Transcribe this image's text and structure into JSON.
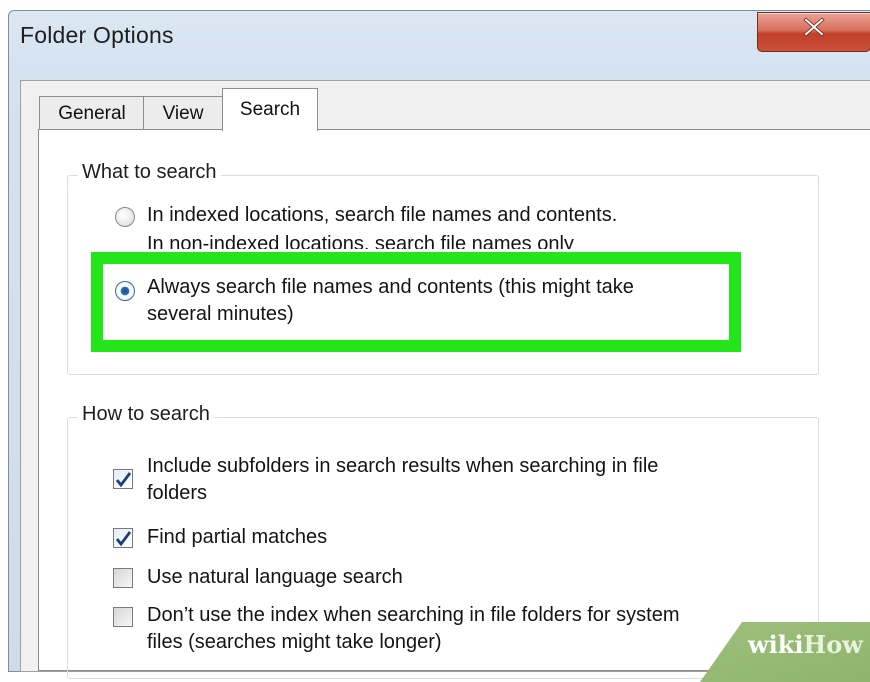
{
  "window": {
    "title": "Folder Options",
    "close_icon": "close-x-icon"
  },
  "tabs": [
    {
      "label": "General",
      "active": false
    },
    {
      "label": "View",
      "active": false
    },
    {
      "label": "Search",
      "active": true
    }
  ],
  "what_to_search": {
    "legend": "What to search",
    "options": [
      {
        "line1": "In indexed locations, search file names and contents.",
        "line2": "In non-indexed locations, search file names only",
        "selected": false
      },
      {
        "line1": "Always search file names and contents (this might take",
        "line2": "several minutes)",
        "selected": true
      }
    ]
  },
  "how_to_search": {
    "legend": "How to search",
    "options": [
      {
        "line1": "Include subfolders in search results when searching in file",
        "line2": "folders",
        "checked": true
      },
      {
        "line1": "Find partial matches",
        "checked": true
      },
      {
        "line1": "Use natural language search",
        "checked": false
      },
      {
        "line1": "Don’t use the index when searching in file folders for system",
        "line2": "files (searches might take longer)",
        "checked": false
      }
    ]
  },
  "colors": {
    "highlight": "#22e51a",
    "radio_selected": "#2d72b8"
  },
  "watermark": {
    "part1": "wiki",
    "part2": "How"
  }
}
